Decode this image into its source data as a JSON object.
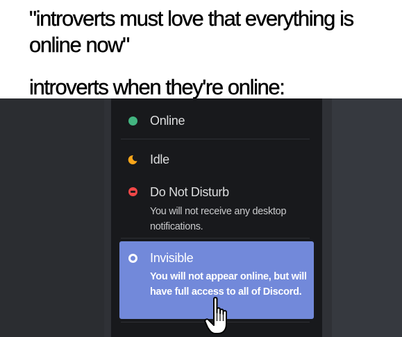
{
  "captions": {
    "top": "\"introverts must love that everything is online now\"",
    "bottom": "introverts when they're online:"
  },
  "status_menu": {
    "items": [
      {
        "label": "Online",
        "color": "#43b581",
        "icon": "online-dot-icon"
      },
      {
        "label": "Idle",
        "color": "#faa61a",
        "icon": "idle-moon-icon"
      },
      {
        "label": "Do Not Disturb",
        "description": "You will not receive any desktop notifications.",
        "color": "#f04747",
        "icon": "dnd-icon"
      },
      {
        "label": "Invisible",
        "description": "You will not appear online, but will have full access to all of Discord.",
        "color": "#747f8d",
        "icon": "invisible-ring-icon",
        "highlighted": true
      }
    ],
    "highlight_color": "#7289da",
    "menu_background": "#18191c"
  },
  "cursor": {
    "icon": "hand-pointer-icon"
  }
}
